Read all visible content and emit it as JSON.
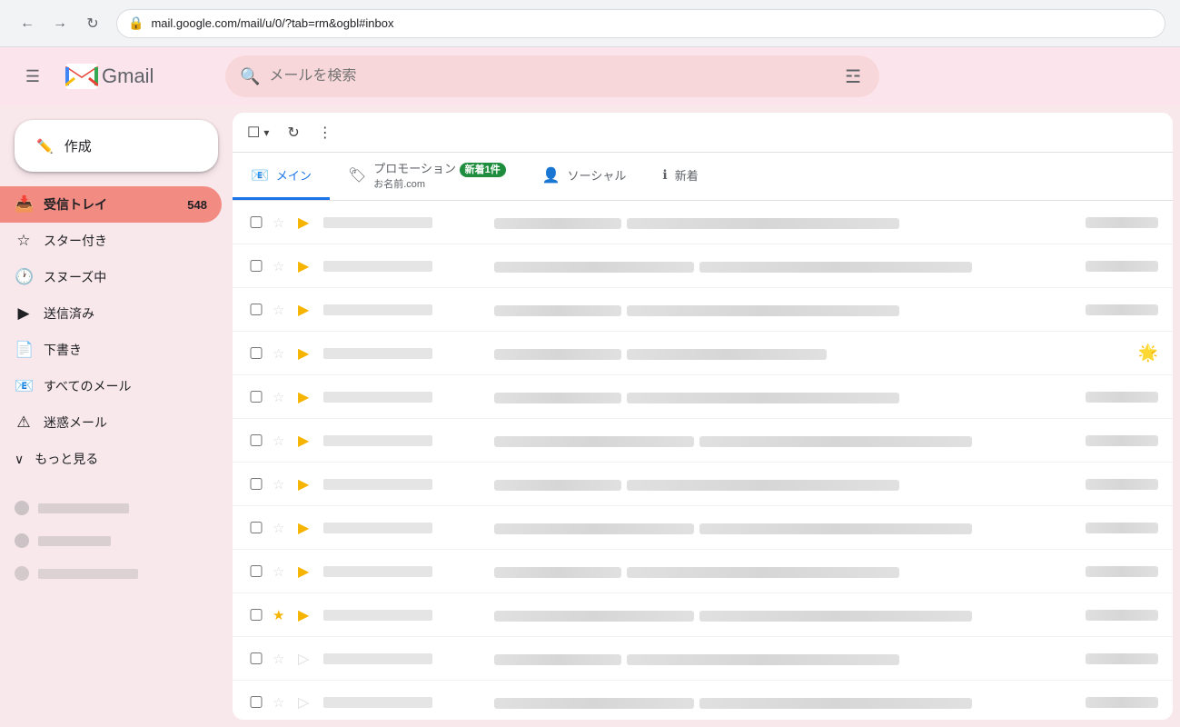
{
  "browser": {
    "url": "mail.google.com/mail/u/0/?tab=rm&ogbl#inbox",
    "back_title": "戻る",
    "forward_title": "進む",
    "reload_title": "再読み込み"
  },
  "header": {
    "hamburger_label": "≡",
    "gmail_label": "Gmail",
    "search_placeholder": "メールを検索",
    "filter_icon": "⚙",
    "m_letter": "M"
  },
  "sidebar": {
    "compose_label": "作成",
    "compose_icon": "✏",
    "nav_items": [
      {
        "icon": "📥",
        "label": "受信トレイ",
        "count": "548",
        "active": true
      },
      {
        "icon": "☆",
        "label": "スター付き",
        "count": "",
        "active": false
      },
      {
        "icon": "🕐",
        "label": "スヌーズ中",
        "count": "",
        "active": false
      },
      {
        "icon": "▶",
        "label": "送信済み",
        "count": "",
        "active": false
      },
      {
        "icon": "📄",
        "label": "下書き",
        "count": "",
        "active": false
      },
      {
        "icon": "📧",
        "label": "すべてのメール",
        "count": "",
        "active": false
      },
      {
        "icon": "⚠",
        "label": "迷惑メール",
        "count": "",
        "active": false
      }
    ],
    "more_label": "もっと見る",
    "more_icon": "∨"
  },
  "tabs": [
    {
      "id": "main",
      "icon": "📧",
      "label": "メイン",
      "active": true
    },
    {
      "id": "promo",
      "icon": "🏷",
      "label": "プロモーション",
      "badge": "新着1件",
      "subtitle": "お名前.com",
      "active": false
    },
    {
      "id": "social",
      "icon": "👤",
      "label": "ソーシャル",
      "active": false
    },
    {
      "id": "new",
      "icon": "ℹ",
      "label": "新着",
      "active": false
    }
  ],
  "toolbar": {
    "select_label": "□",
    "refresh_label": "↻",
    "more_label": "⋮"
  },
  "emails": [
    {
      "id": 1,
      "starred": false,
      "important": true,
      "sender_redacted": true,
      "has_emoji": false
    },
    {
      "id": 2,
      "starred": false,
      "important": true,
      "sender_redacted": true,
      "has_emoji": false
    },
    {
      "id": 3,
      "starred": false,
      "important": true,
      "sender_redacted": true,
      "has_emoji": false
    },
    {
      "id": 4,
      "starred": false,
      "important": true,
      "sender_redacted": true,
      "has_emoji": true,
      "emoji": "🌟"
    },
    {
      "id": 5,
      "starred": false,
      "important": true,
      "sender_redacted": true,
      "has_emoji": false
    },
    {
      "id": 6,
      "starred": false,
      "important": true,
      "sender_redacted": true,
      "has_emoji": false
    },
    {
      "id": 7,
      "starred": false,
      "important": true,
      "sender_redacted": true,
      "has_emoji": false
    },
    {
      "id": 8,
      "starred": false,
      "important": true,
      "sender_redacted": true,
      "has_emoji": false
    },
    {
      "id": 9,
      "starred": false,
      "important": true,
      "sender_redacted": true,
      "has_emoji": false
    },
    {
      "id": 10,
      "starred": false,
      "important": true,
      "sender_redacted": true,
      "has_emoji": false
    },
    {
      "id": 11,
      "starred": false,
      "important": false,
      "sender_redacted": true,
      "has_emoji": false
    },
    {
      "id": 12,
      "starred": false,
      "important": false,
      "sender_redacted": true,
      "has_emoji": false
    }
  ],
  "colors": {
    "accent_blue": "#1a73e8",
    "active_tab_underline": "#1a73e8",
    "inbox_bg": "#fce4ec",
    "active_nav": "#f28b82",
    "badge_green": "#1e8e3e",
    "important_yellow": "#f4b400"
  }
}
